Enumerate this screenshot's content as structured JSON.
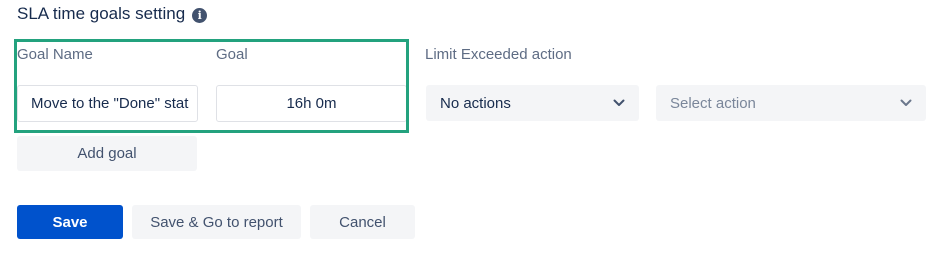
{
  "header": {
    "title": "SLA time goals setting",
    "info_icon": "info-icon"
  },
  "columns": {
    "goal_name": "Goal Name",
    "goal": "Goal",
    "limit_exceeded_action": "Limit Exceeded action"
  },
  "goal_row": {
    "name_value": "Move to the \"Done\" stat",
    "goal_value": "16h 0m",
    "action_value": "No actions",
    "select_action_placeholder": "Select action"
  },
  "buttons": {
    "add_goal": "Add goal",
    "save": "Save",
    "save_go_report": "Save & Go to report",
    "cancel": "Cancel"
  },
  "colors": {
    "primary": "#0052cc",
    "highlight": "#23a27e",
    "text": "#172b4d",
    "muted": "#5e6c84"
  }
}
